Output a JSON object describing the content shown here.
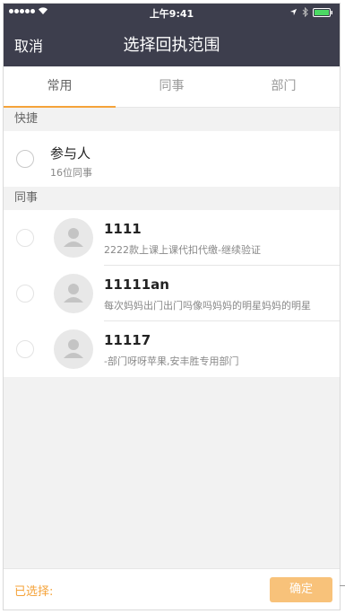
{
  "status_bar": {
    "time": "上午9:41"
  },
  "nav": {
    "cancel_label": "取消",
    "title": "选择回执范围"
  },
  "tabs": [
    {
      "label": "常用",
      "active": true
    },
    {
      "label": "同事",
      "active": false
    },
    {
      "label": "部门",
      "active": false
    }
  ],
  "sections": {
    "shortcut_title": "快捷",
    "colleagues_title": "同事"
  },
  "shortcut": {
    "title": "参与人",
    "subtitle": "16位同事"
  },
  "colleagues": [
    {
      "name": "1111",
      "dept": "2222款上课上课代扣代缴-继续验证"
    },
    {
      "name": "11111an",
      "dept": "每次妈妈出门出门吗像吗妈妈的明星妈妈的明星"
    },
    {
      "name": "11117",
      "dept": "-部门呀呀苹果,安丰胜专用部门"
    }
  ],
  "bottom": {
    "selected_label": "已选择:",
    "confirm_label": "确定"
  },
  "colors": {
    "nav_bg": "#3d3e4d",
    "accent": "#f5a33a",
    "confirm_bg": "#f8c27a"
  },
  "icons": [
    "signal-dots-icon",
    "wifi-icon",
    "location-arrow-icon",
    "bluetooth-icon",
    "battery-icon",
    "person-avatar-icon"
  ]
}
